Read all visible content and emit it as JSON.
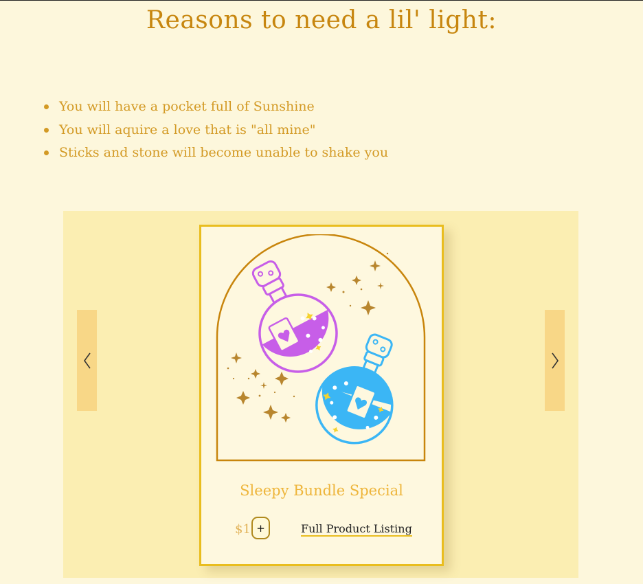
{
  "heading": "Reasons to need a lil' light:",
  "reasons": [
    "You will have a pocket full of Sunshine",
    "You will aquire a love that is \"all mine\"",
    "Sticks and stone will become unable to shake you"
  ],
  "carousel": {
    "prev_icon": "chevron-left-icon",
    "next_icon": "chevron-right-icon",
    "product": {
      "title": "Sleepy Bundle Special",
      "price": "$1",
      "add_label": "+",
      "link_label": "Full Product Listing",
      "image": "potion-bottles-illustration"
    }
  },
  "colors": {
    "page_background": "#fdf7dc",
    "heading": "#c7860f",
    "list_text": "#d39a25",
    "carousel_background": "#fbeeb2",
    "arrow_background": "#f8d787",
    "card_border": "#e9bd1e",
    "arch_border": "#c8850c",
    "product_title": "#eeb53a",
    "purple_potion": "#c75ee8",
    "blue_potion": "#3bb6f5"
  }
}
